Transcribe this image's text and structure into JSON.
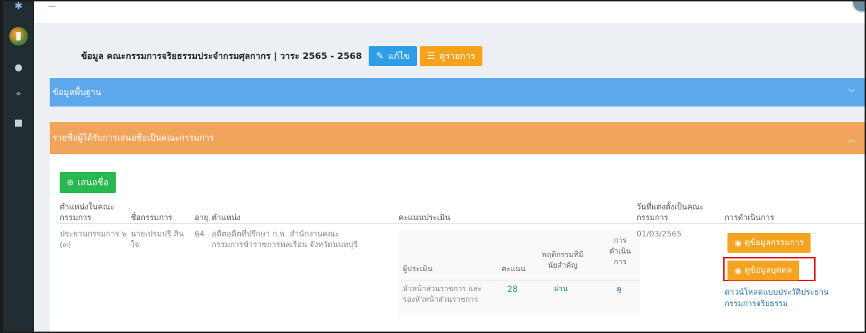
{
  "sidebar": {
    "items": [
      {
        "icon": "star-icon",
        "glyph": "✱"
      },
      {
        "icon": "logo-icon",
        "glyph": ""
      },
      {
        "icon": "dashboard-icon",
        "glyph": "●"
      },
      {
        "icon": "group-icon",
        "glyph": "⚭"
      },
      {
        "icon": "user-icon",
        "glyph": "■"
      }
    ]
  },
  "header": {
    "title": "ข้อมูล คณะกรรมการจริยธรรมประจำกรมศุลกากร | วาระ 2565 - 2568",
    "edit_label": "แก้ไข",
    "list_label": "ดูรายการ"
  },
  "panels": {
    "basic_label": "ข้อมูลพื้นฐาน",
    "nominees_label": "รายชื่อผู้ได้รับการเสนอชื่อเป็นคณะกรรมการ"
  },
  "propose_label": "เสนอชื่อ",
  "table": {
    "headers": {
      "position_line1": "ตำแหน่งในคณะ",
      "position_line2": "กรรมการ",
      "name": "ชื่อกรรมการ",
      "age": "อายุ",
      "job": "ตำแหน่ง",
      "score": "คะแนนประเมิน",
      "appoint_line1": "วันที่แต่งตั้งเป็นคณะ",
      "appoint_line2": "กรรมการ",
      "actions": "การดำเนินการ"
    },
    "row": {
      "position_line1": "ประธานกรรมการ ๖",
      "position_line2": "(๓)",
      "name_line1": "นายเปรมปรี สิน",
      "name_line2": "ใจ",
      "age": "64",
      "job_line1": "อดีตอดีตที่ปรึกษา ก.พ. สำนักงานคณะ",
      "job_line2": "กรรมการข้าราชการพลเรือน จังหวัดนนทบุรี",
      "appoint_date": "01/03/2565",
      "btn_committee": "ดูข้อมูลกรรมการ",
      "btn_person": "ดูข้อมูลบุคคล",
      "download_line1": "ดาวน์โหลดแบบประวัติประธาน",
      "download_line2": "กรรมการจริยธรรม"
    },
    "eval": {
      "h_assessor": "ผู้ประเมิน",
      "h_score": "คะแนน",
      "h_behavior_line1": "พฤติกรรมที่มี",
      "h_behavior_line2": "นัยสำคัญ",
      "h_action_line1": "การ",
      "h_action_line2": "ดำเนิน",
      "h_action_line3": "การ",
      "assessor_line1": "หัวหน้าส่วนราชการ และ",
      "assessor_line2": "รองหัวหน้าส่วนราชการ",
      "score": "28",
      "behavior": "ผ่าน",
      "action": "ดู"
    }
  },
  "colors": {
    "sidebar": "#222d32",
    "panel_blue": "#5da8ec",
    "panel_orange": "#f2a45b",
    "btn_edit": "#2e9fe6",
    "btn_orange": "#f4a421",
    "btn_green": "#27b84f",
    "highlight": "#e01010",
    "score_green": "#27a043",
    "link_blue": "#2a6fb0"
  }
}
